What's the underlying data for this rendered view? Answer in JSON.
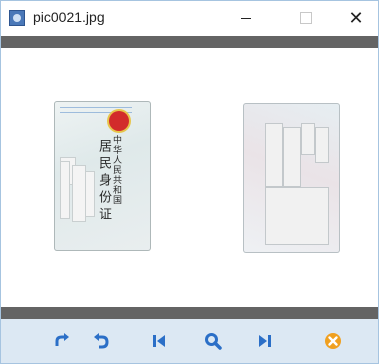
{
  "window": {
    "title": "pic0021.jpg",
    "controls": {
      "minimize": "—",
      "maximize": "☐",
      "close": "✕"
    }
  },
  "viewer": {
    "images": [
      {
        "name": "id-card-front",
        "text_line1": "中华人民共和国",
        "text_line2": "居民身份证"
      },
      {
        "name": "id-card-back"
      }
    ]
  },
  "toolbar": {
    "buttons": [
      {
        "name": "rotate-clockwise",
        "icon": "rotate-cw-icon"
      },
      {
        "name": "rotate-counterclockwise",
        "icon": "rotate-ccw-icon"
      },
      {
        "name": "previous-image",
        "icon": "skip-previous-icon"
      },
      {
        "name": "zoom",
        "icon": "magnifier-icon"
      },
      {
        "name": "next-image",
        "icon": "skip-next-icon"
      },
      {
        "name": "delete",
        "icon": "delete-icon"
      }
    ]
  },
  "colors": {
    "accent": "#2b6fc7",
    "delete": "#f0a020",
    "toolbar_bg": "#dce8f3",
    "bar_gray": "#646464"
  }
}
